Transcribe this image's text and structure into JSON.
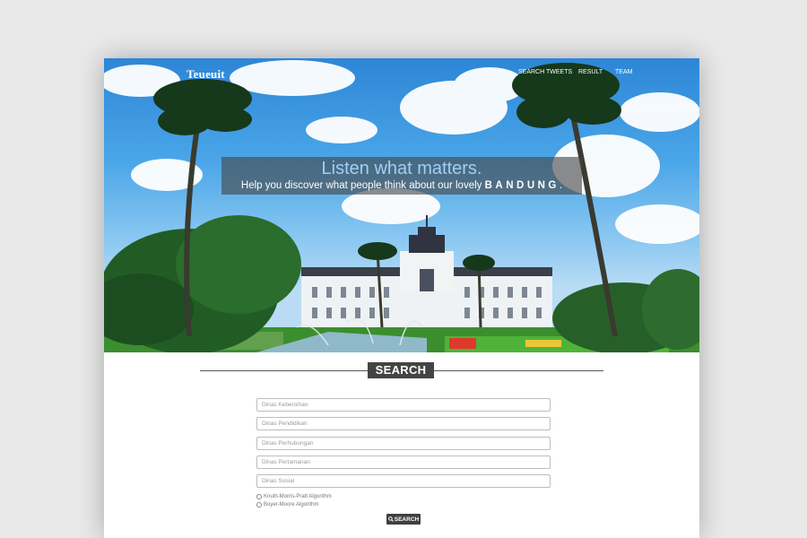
{
  "navbar": {
    "brand": "Teueuit",
    "links": [
      {
        "label": "SEARCH TWEETS"
      },
      {
        "label": "RESULT"
      },
      {
        "label": "TEAM"
      }
    ]
  },
  "hero": {
    "headline": "Listen what matters.",
    "subline_prefix": "Help you discover what people think about our lovely ",
    "subline_city": "BANDUNG",
    "subline_suffix": "."
  },
  "search": {
    "title": "SEARCH",
    "fields": [
      {
        "placeholder": "Dinas Kebersihan"
      },
      {
        "placeholder": "Dinas Pendidikan"
      },
      {
        "placeholder": "Dinas Perhubungan"
      },
      {
        "placeholder": "Dinas Pertamanan"
      },
      {
        "placeholder": "Dinas Sosial"
      }
    ],
    "algorithms": [
      {
        "label": "Knuth-Morris-Pratt Algorithm"
      },
      {
        "label": "Boyer-Moore Algorithm"
      }
    ],
    "button_label": "SEARCH",
    "button_icon": "search-icon"
  }
}
